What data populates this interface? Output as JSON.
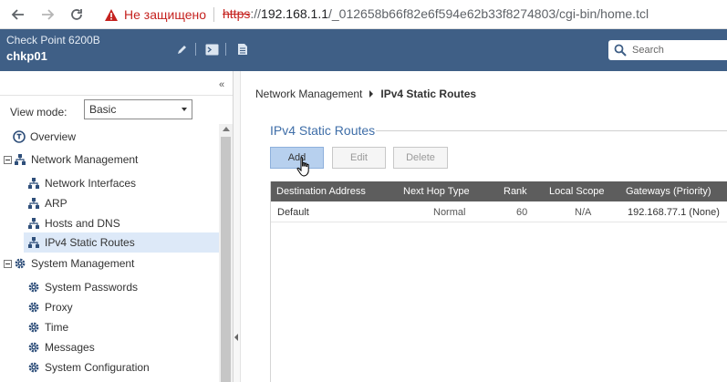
{
  "browser": {
    "security_text": "Не защищено",
    "url_scheme": "https",
    "url_host": "192.168.1.1",
    "url_path": "/_012658b66f82e6f594e62b33f8274803/cgi-bin/home.tcl"
  },
  "header": {
    "product": "Check Point 6200B",
    "hostname": "chkp01",
    "search_placeholder": "Search"
  },
  "sidebar": {
    "view_mode_label": "View mode:",
    "view_mode_value": "Basic",
    "items": [
      {
        "label": "Overview",
        "icon": "overview-icon"
      },
      {
        "label": "Network Management",
        "icon": "network-icon"
      },
      {
        "label": "Network Interfaces",
        "icon": "network-icon"
      },
      {
        "label": "ARP",
        "icon": "network-icon"
      },
      {
        "label": "Hosts and DNS",
        "icon": "network-icon"
      },
      {
        "label": "IPv4 Static Routes",
        "icon": "network-icon",
        "selected": true
      },
      {
        "label": "System Management",
        "icon": "gear-icon"
      },
      {
        "label": "System Passwords",
        "icon": "gear-icon"
      },
      {
        "label": "Proxy",
        "icon": "gear-icon"
      },
      {
        "label": "Time",
        "icon": "gear-icon"
      },
      {
        "label": "Messages",
        "icon": "gear-icon"
      },
      {
        "label": "System Configuration",
        "icon": "gear-icon"
      }
    ]
  },
  "main": {
    "breadcrumb_parent": "Network Management",
    "breadcrumb_current": "IPv4 Static Routes",
    "section_title": "IPv4 Static Routes",
    "buttons": {
      "add": "Add",
      "edit": "Edit",
      "delete": "Delete"
    },
    "columns": [
      "Destination Address",
      "Next Hop Type",
      "Rank",
      "Local Scope",
      "Gateways (Priority)"
    ],
    "rows": [
      [
        "Default",
        "Normal",
        "60",
        "N/A",
        "192.168.77.1 (None)"
      ]
    ]
  },
  "colors": {
    "header_bg": "#3f5f86",
    "accent": "#3f6ea8",
    "grid_header": "#5d5d5d",
    "selected_bg": "#dde9f8",
    "insecure": "#c5221f"
  }
}
